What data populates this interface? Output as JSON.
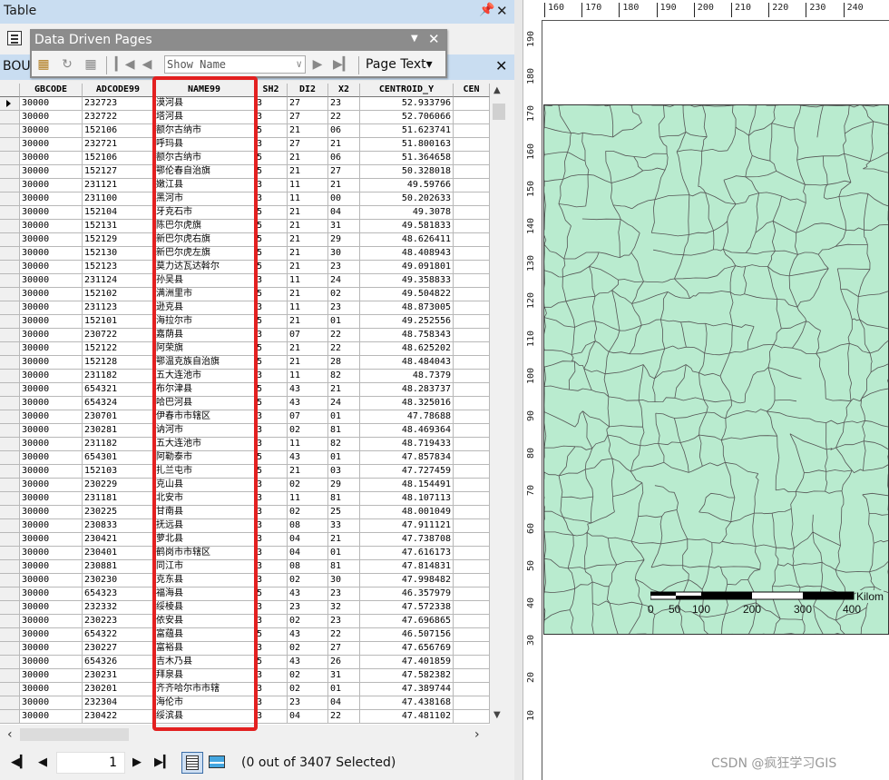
{
  "window": {
    "title": "Table",
    "pin_glyph": "ب",
    "close_glyph": "✕"
  },
  "tab": {
    "label": "BOU",
    "close_glyph": "✕"
  },
  "ddp_toolbar": {
    "title": "Data Driven Pages",
    "show_field": "Show Name",
    "page_text_label": "Page Text▾"
  },
  "table": {
    "columns": [
      "GBCODE",
      "ADCODE99",
      "NAME99",
      "SH2",
      "DI2",
      "X2",
      "CENTROID_Y",
      "CEN"
    ],
    "rows": [
      [
        "30000",
        "232723",
        "漠河县",
        "3",
        "27",
        "23",
        "52.933796"
      ],
      [
        "30000",
        "232722",
        "塔河县",
        "3",
        "27",
        "22",
        "52.706066"
      ],
      [
        "30000",
        "152106",
        "额尔古纳市",
        "5",
        "21",
        "06",
        "51.623741"
      ],
      [
        "30000",
        "232721",
        "呼玛县",
        "3",
        "27",
        "21",
        "51.800163"
      ],
      [
        "30000",
        "152106",
        "额尔古纳市",
        "5",
        "21",
        "06",
        "51.364658"
      ],
      [
        "30000",
        "152127",
        "鄂伦春自治旗",
        "5",
        "21",
        "27",
        "50.328018"
      ],
      [
        "30000",
        "231121",
        "嫩江县",
        "3",
        "11",
        "21",
        "49.59766"
      ],
      [
        "30000",
        "231100",
        "黑河市",
        "3",
        "11",
        "00",
        "50.202633"
      ],
      [
        "30000",
        "152104",
        "牙克石市",
        "5",
        "21",
        "04",
        "49.3078"
      ],
      [
        "30000",
        "152131",
        "陈巴尔虎旗",
        "5",
        "21",
        "31",
        "49.581833"
      ],
      [
        "30000",
        "152129",
        "新巴尔虎右旗",
        "5",
        "21",
        "29",
        "48.626411"
      ],
      [
        "30000",
        "152130",
        "新巴尔虎左旗",
        "5",
        "21",
        "30",
        "48.408943"
      ],
      [
        "30000",
        "152123",
        "莫力达瓦达斡尔",
        "5",
        "21",
        "23",
        "49.091801"
      ],
      [
        "30000",
        "231124",
        "孙吴县",
        "3",
        "11",
        "24",
        "49.358833"
      ],
      [
        "30000",
        "152102",
        "满洲里市",
        "5",
        "21",
        "02",
        "49.504822"
      ],
      [
        "30000",
        "231123",
        "逊克县",
        "3",
        "11",
        "23",
        "48.873005"
      ],
      [
        "30000",
        "152101",
        "海拉尔市",
        "5",
        "21",
        "01",
        "49.252556"
      ],
      [
        "30000",
        "230722",
        "嘉荫县",
        "3",
        "07",
        "22",
        "48.758343"
      ],
      [
        "30000",
        "152122",
        "阿荣旗",
        "5",
        "21",
        "22",
        "48.625202"
      ],
      [
        "30000",
        "152128",
        "鄂温克族自治旗",
        "5",
        "21",
        "28",
        "48.484043"
      ],
      [
        "30000",
        "231182",
        "五大连池市",
        "3",
        "11",
        "82",
        "48.7379"
      ],
      [
        "30000",
        "654321",
        "布尔津县",
        "5",
        "43",
        "21",
        "48.283737"
      ],
      [
        "30000",
        "654324",
        "哈巴河县",
        "5",
        "43",
        "24",
        "48.325016"
      ],
      [
        "30000",
        "230701",
        "伊春市市辖区",
        "3",
        "07",
        "01",
        "47.78688"
      ],
      [
        "30000",
        "230281",
        "讷河市",
        "3",
        "02",
        "81",
        "48.469364"
      ],
      [
        "30000",
        "231182",
        "五大连池市",
        "3",
        "11",
        "82",
        "48.719433"
      ],
      [
        "30000",
        "654301",
        "阿勒泰市",
        "5",
        "43",
        "01",
        "47.857834"
      ],
      [
        "30000",
        "152103",
        "扎兰屯市",
        "5",
        "21",
        "03",
        "47.727459"
      ],
      [
        "30000",
        "230229",
        "克山县",
        "3",
        "02",
        "29",
        "48.154491"
      ],
      [
        "30000",
        "231181",
        "北安市",
        "3",
        "11",
        "81",
        "48.107113"
      ],
      [
        "30000",
        "230225",
        "甘南县",
        "3",
        "02",
        "25",
        "48.001049"
      ],
      [
        "30000",
        "230833",
        "抚远县",
        "3",
        "08",
        "33",
        "47.911121"
      ],
      [
        "30000",
        "230421",
        "萝北县",
        "3",
        "04",
        "21",
        "47.738708"
      ],
      [
        "30000",
        "230401",
        "鹤岗市市辖区",
        "3",
        "04",
        "01",
        "47.616173"
      ],
      [
        "30000",
        "230881",
        "同江市",
        "3",
        "08",
        "81",
        "47.814831"
      ],
      [
        "30000",
        "230230",
        "克东县",
        "3",
        "02",
        "30",
        "47.998482"
      ],
      [
        "30000",
        "654323",
        "福海县",
        "5",
        "43",
        "23",
        "46.357979"
      ],
      [
        "30000",
        "232332",
        "绥棱县",
        "3",
        "23",
        "32",
        "47.572338"
      ],
      [
        "30000",
        "230223",
        "依安县",
        "3",
        "02",
        "23",
        "47.696865"
      ],
      [
        "30000",
        "654322",
        "富蕴县",
        "5",
        "43",
        "22",
        "46.507156"
      ],
      [
        "30000",
        "230227",
        "富裕县",
        "3",
        "02",
        "27",
        "47.656769"
      ],
      [
        "30000",
        "654326",
        "吉木乃县",
        "5",
        "43",
        "26",
        "47.401859"
      ],
      [
        "30000",
        "230231",
        "拜泉县",
        "3",
        "02",
        "31",
        "47.582382"
      ],
      [
        "30000",
        "230201",
        "齐齐哈尔市市辖",
        "3",
        "02",
        "01",
        "47.389744"
      ],
      [
        "30000",
        "232304",
        "海伦市",
        "3",
        "23",
        "04",
        "47.438168"
      ],
      [
        "30000",
        "230422",
        "绥滨县",
        "3",
        "04",
        "22",
        "47.481102"
      ]
    ]
  },
  "status": {
    "current_record": "1",
    "selection_text": "(0 out of 3407 Selected)"
  },
  "ruler": {
    "horizontal_ticks": [
      "160",
      "170",
      "180",
      "190",
      "200",
      "210",
      "220",
      "230",
      "240"
    ],
    "vertical_ticks": [
      "190",
      "180",
      "170",
      "160",
      "150",
      "140",
      "130",
      "120",
      "110",
      "100",
      "90",
      "80",
      "70",
      "60",
      "50",
      "40",
      "30",
      "20",
      "10"
    ]
  },
  "scale_bar": {
    "labels": [
      "0",
      "50",
      "100",
      "200",
      "300",
      "400"
    ],
    "unit": "Kilom"
  },
  "map": {
    "fill_color": "#b9ebcf",
    "boundary_color": "#555555"
  },
  "highlight": {
    "color": "#e32020"
  },
  "watermark": "CSDN @疯狂学习GIS"
}
